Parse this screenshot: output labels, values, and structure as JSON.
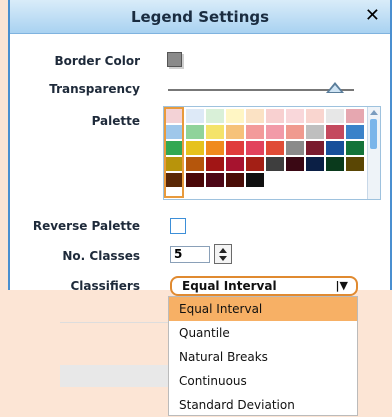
{
  "dialog": {
    "title": "Legend Settings",
    "close_symbol": "✕",
    "labels": {
      "border_color": "Border Color",
      "transparency": "Transparency",
      "palette": "Palette",
      "reverse_palette": "Reverse Palette",
      "no_classes": "No. Classes",
      "classifiers": "Classifiers"
    },
    "transparency_value": 0.9,
    "no_classes_value": "5",
    "reverse_palette_checked": false,
    "classifier_selected": "Equal Interval",
    "dropdown_arrow": "|▼"
  },
  "dropdown": {
    "options": [
      "Equal Interval",
      "Quantile",
      "Natural Breaks",
      "Continuous",
      "Standard Deviation"
    ],
    "selected_index": 0
  },
  "palette": {
    "rows": [
      [
        "#f3d2d6",
        "#dde9f7",
        "#d9f0d8",
        "#fff6c4",
        "#fbe2c4",
        "#f8d0d0",
        "#f9d7da",
        "#f9d5cf",
        "#e7e7e7"
      ],
      [
        "#e6a7b0",
        "#9fc7ea",
        "#8fd39a",
        "#f4e36a",
        "#f6c27a",
        "#f39a9a",
        "#f29aa8",
        "#f09a8f",
        "#bfbfbf"
      ],
      [
        "#c4495e",
        "#3a82c9",
        "#32a852",
        "#e6c21c",
        "#f08a1e",
        "#e03b3b",
        "#e2435c",
        "#e04c37",
        "#8a8a8a"
      ],
      [
        "#7a1b2e",
        "#174f9a",
        "#13733a",
        "#b8940b",
        "#b5560c",
        "#a11515",
        "#a7132f",
        "#a31f15",
        "#3e3e3e"
      ],
      [
        "#3a0814",
        "#0b1f45",
        "#0a3a1c",
        "#5a4604",
        "#5a2806",
        "#4a0707",
        "#4d0716",
        "#4a0d07",
        "#101010"
      ]
    ]
  },
  "colors": {
    "accent_orange": "#e08a30",
    "title_blue": "#a9d2f1"
  }
}
